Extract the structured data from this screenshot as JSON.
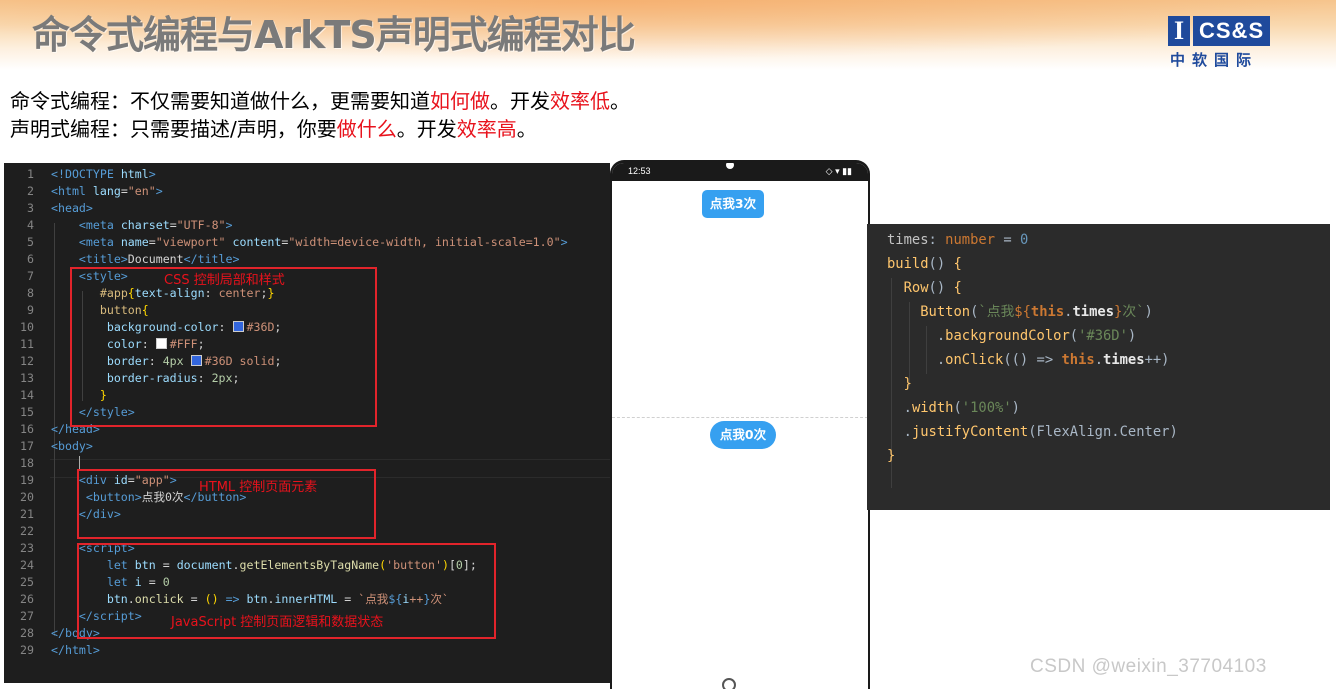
{
  "header": {
    "title": "命令式编程与ArkTS声明式编程对比",
    "logo": {
      "mark": "I",
      "brand": "CS&S",
      "chinese": "中软国际"
    }
  },
  "intro": {
    "line1": {
      "prefix": "命令式编程：不仅需要知道做什么，更需要知道",
      "highlight1": "如何做",
      "middle": "。开发",
      "highlight2": "效率低",
      "suffix": "。"
    },
    "line2": {
      "prefix": "声明式编程：只需要描述/声明，你要",
      "highlight1": "做什么",
      "middle": "。开发",
      "highlight2": "效率高",
      "suffix": "。"
    }
  },
  "html_code": {
    "line_numbers": [
      "1",
      "2",
      "3",
      "4",
      "5",
      "6",
      "7",
      "8",
      "9",
      "10",
      "11",
      "12",
      "13",
      "14",
      "15",
      "16",
      "17",
      "18",
      "19",
      "20",
      "21",
      "22",
      "23",
      "24",
      "25",
      "26",
      "27",
      "28",
      "29"
    ],
    "annotations": {
      "css": "CSS 控制局部和样式",
      "html": "HTML 控制页面元素",
      "js": "JavaScript 控制页面逻辑和数据状态"
    }
  },
  "phone": {
    "time": "12:53",
    "signal": "◇ ▾ ▮▮",
    "button_top": "点我3次",
    "button_bottom": "点我0次"
  },
  "arkts_code": {
    "lines": [
      "times: number = 0",
      "build() {",
      "  Row() {",
      "    Button(`点我${this.times}次`)",
      "      .backgroundColor('#36D')",
      "      .onClick(() => this.times++)",
      "  }",
      "  .width('100%')",
      "  .justifyContent(FlexAlign.Center)",
      "}"
    ]
  },
  "watermark": "CSDN @weixin_37704103",
  "colors": {
    "accent_red": "#e8121c",
    "brand_blue": "#1f4a9c",
    "button_blue": "#36a0f0",
    "code_bg": "#1e1e1e",
    "ark_bg": "#2b2b2b"
  }
}
